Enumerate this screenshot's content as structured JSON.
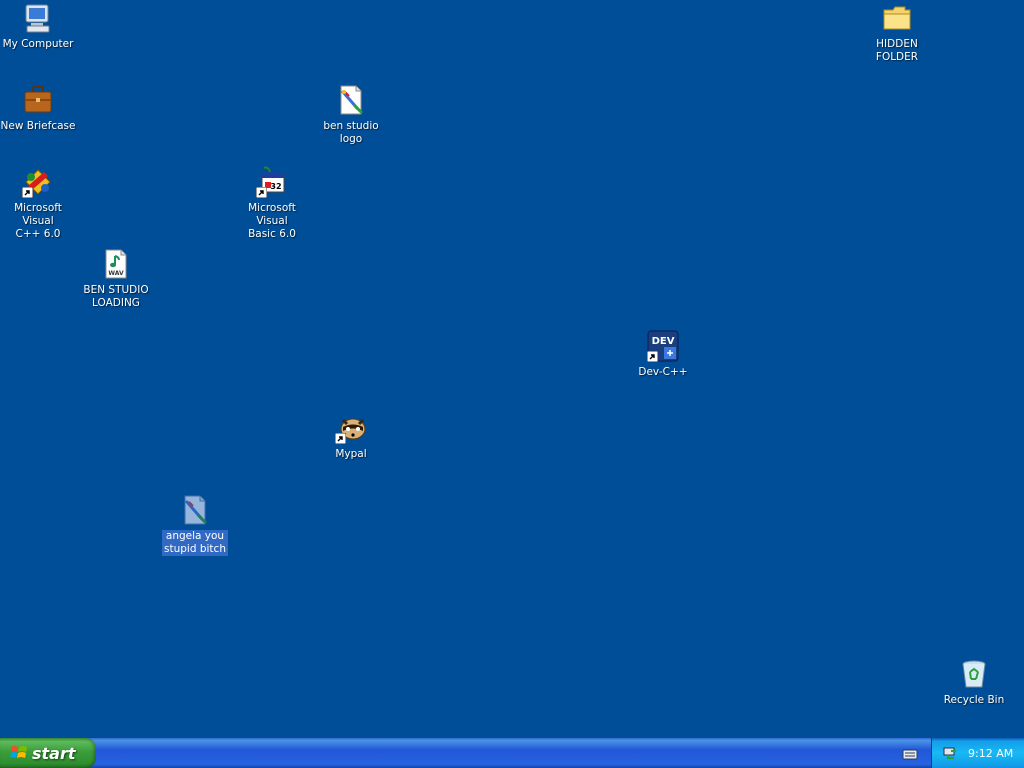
{
  "desktop": {
    "background_color": "#004E98",
    "selection_color": "#316AC5",
    "icons": [
      {
        "label": "My Computer",
        "icon": "computer-icon",
        "shortcut": false
      },
      {
        "label": "New Briefcase",
        "icon": "briefcase-icon",
        "shortcut": false
      },
      {
        "label": "Microsoft Visual\nC++ 6.0",
        "icon": "visual-cpp-icon",
        "shortcut": true
      },
      {
        "label": "BEN STUDIO\nLOADING",
        "icon": "wav-file-icon",
        "shortcut": false
      },
      {
        "label": "ben studio logo",
        "icon": "paint-image-icon",
        "shortcut": false
      },
      {
        "label": "Microsoft Visual\nBasic 6.0",
        "icon": "visual-basic-icon",
        "shortcut": true
      },
      {
        "label": "Mypal",
        "icon": "mypal-raccoon-icon",
        "shortcut": true
      },
      {
        "label": "angela you\nstupid bitch",
        "icon": "paint-image-icon",
        "shortcut": false,
        "selected": true
      },
      {
        "label": "Dev-C++",
        "icon": "dev-cpp-icon",
        "shortcut": true,
        "icon_text": "DEV"
      },
      {
        "label": "HIDDEN\nFOLDER",
        "icon": "folder-icon",
        "shortcut": false
      },
      {
        "label": "Recycle Bin",
        "icon": "recycle-bin-icon",
        "shortcut": false
      }
    ]
  },
  "taskbar": {
    "start_label": "start",
    "start_color": "#3A9E3A",
    "bar_color": "#2157D7",
    "tray_color": "#18B9F4",
    "clock": "9:12 AM",
    "tray_icons": [
      "network-tray-icon"
    ],
    "indicator": "keyboard-icon"
  }
}
